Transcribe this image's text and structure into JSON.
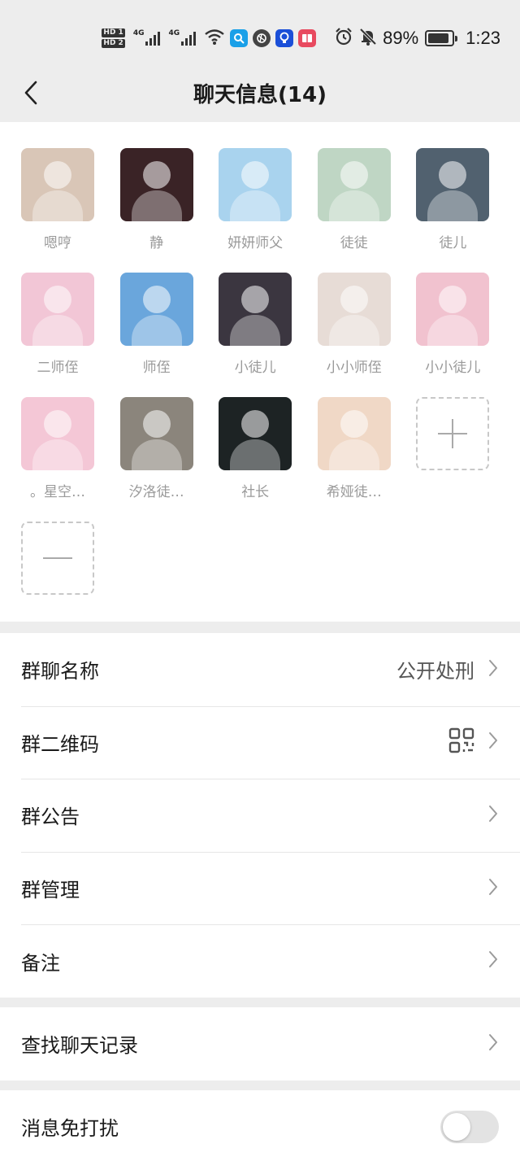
{
  "status_bar": {
    "hd1": "HD 1",
    "hd2": "HD 2",
    "net1": "4G",
    "net2": "4G",
    "battery_text": "89%",
    "battery_level": 0.89,
    "time": "1:23",
    "icons": [
      "wifi-icon",
      "search-app-icon",
      "aperture-app-icon",
      "bulb-app-icon",
      "book-app-icon",
      "alarm-icon",
      "mute-bell-icon",
      "battery-icon"
    ]
  },
  "header": {
    "title": "聊天信息(14)",
    "back_icon": "chevron-left-icon"
  },
  "members": [
    {
      "name": "嗯哼",
      "color": "#d9c6b7"
    },
    {
      "name": "静",
      "color": "#3a2326"
    },
    {
      "name": "妍妍师父",
      "color": "#a9d3ee"
    },
    {
      "name": "徒徒",
      "color": "#bfd6c4"
    },
    {
      "name": "徒儿",
      "color": "#51616f"
    },
    {
      "name": "二师侄",
      "color": "#f2c6d6"
    },
    {
      "name": "师侄",
      "color": "#6aa6dc"
    },
    {
      "name": "小徒儿",
      "color": "#3b3640"
    },
    {
      "name": "小小师侄",
      "color": "#e7dcd6"
    },
    {
      "name": "小小徒儿",
      "color": "#f1c2cf"
    },
    {
      "name": "。星空…",
      "color": "#f4c7d6"
    },
    {
      "name": "汐洛徒…",
      "color": "#8b857c"
    },
    {
      "name": "社长",
      "color": "#1d2324"
    },
    {
      "name": "希娅徒…",
      "color": "#f0d8c6"
    }
  ],
  "add_member_icon": "plus-icon",
  "remove_member_icon": "minus-icon",
  "settings": {
    "group1": [
      {
        "label": "群聊名称",
        "value": "公开处刑"
      },
      {
        "label": "群二维码",
        "icon": "qr-code-icon"
      },
      {
        "label": "群公告"
      },
      {
        "label": "群管理"
      },
      {
        "label": "备注"
      }
    ],
    "group2": [
      {
        "label": "查找聊天记录"
      }
    ],
    "group3": [
      {
        "label": "消息免打扰",
        "toggle": false
      }
    ]
  },
  "chevron_icon": "chevron-right-icon",
  "colors": {
    "background": "#ededed",
    "card": "#ffffff",
    "label": "#1a1a1a",
    "member_name": "#9a9a9a",
    "toggle_off": "#e3e3e3"
  }
}
